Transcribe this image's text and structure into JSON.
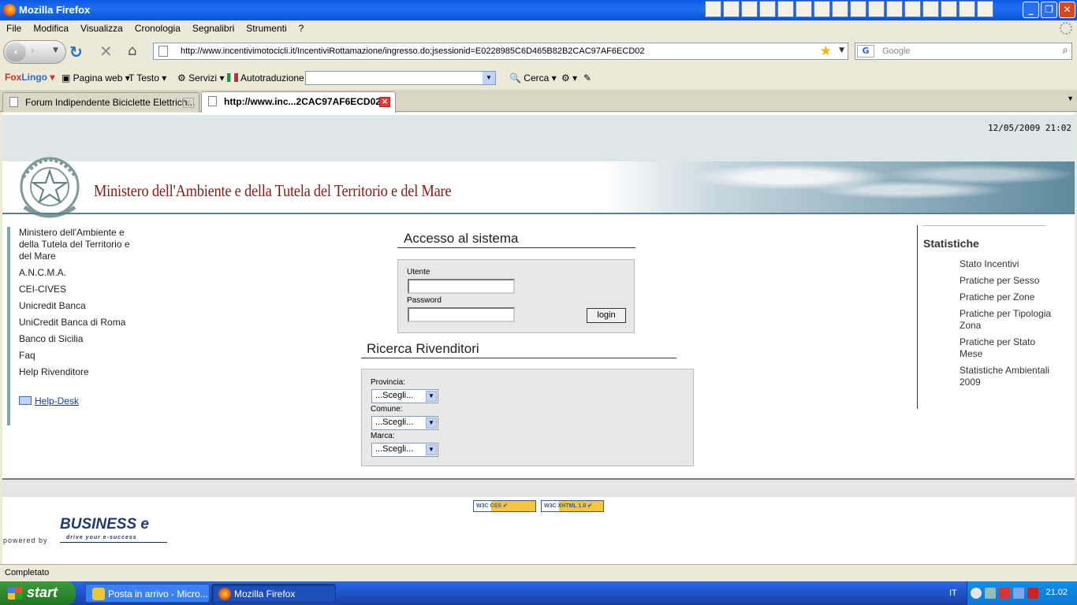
{
  "window": {
    "title": "Mozilla Firefox"
  },
  "menu": [
    "File",
    "Modifica",
    "Visualizza",
    "Cronologia",
    "Segnalibri",
    "Strumenti",
    "?"
  ],
  "nav": {
    "url": "http://www.incentivimotocicli.it/IncentiviRottamazione/ingresso.do;jsessionid=E0228985C6D465B82B2CAC97AF6ECD02",
    "search_placeholder": "Google"
  },
  "foxbar": {
    "brand_part1": "Fox",
    "brand_part2": "Lingo",
    "items": [
      "Pagina web",
      "Testo",
      "Servizi",
      "Autotraduzione",
      "Cerca"
    ]
  },
  "tabs": [
    {
      "label": "Forum Indipendente Biciclette Elettrich...",
      "active": false
    },
    {
      "label": "http://www.inc...2CAC97AF6ECD02",
      "active": true
    }
  ],
  "page": {
    "datetime": "12/05/2009 21:02",
    "ministry_title": "Ministero dell'Ambiente e della Tutela  del Territorio e del Mare",
    "left_nav": [
      "Ministero dell'Ambiente e della Tutela del Territorio e del Mare",
      "A.N.C.M.A.",
      "CEI-CIVES",
      "Unicredit Banca",
      "UniCredit Banca di Roma",
      "Banco di Sicilia",
      "Faq",
      "Help Rivenditore"
    ],
    "helpdesk": "Help-Desk",
    "login": {
      "title": "Accesso al sistema",
      "user_label": "Utente",
      "password_label": "Password",
      "button": "login"
    },
    "search": {
      "title": "Ricerca Rivenditori",
      "provincia_label": "Provincia:",
      "comune_label": "Comune:",
      "marca_label": "Marca:",
      "select_value": "...Scegli..."
    },
    "stats": {
      "heading": "Statistiche",
      "items": [
        "Stato Incentivi",
        "Pratiche per Sesso",
        "Pratiche per Zone",
        "Pratiche per Tipologia Zona",
        "Pratiche per Stato Mese",
        "Statistiche Ambientali 2009"
      ]
    },
    "badges": {
      "css": "W3C CSS ✔",
      "xhtml": "W3C XHTML 1.0 ✔"
    },
    "powered_by": "powered by",
    "business_logo": "BUSINESS e",
    "business_tagline": "drive your e-success"
  },
  "status": "Completato",
  "taskbar": {
    "start": "start",
    "tasks": [
      "Posta in arrivo - Micro...",
      "Mozilla Firefox"
    ],
    "lang": "IT",
    "clock": "21.02"
  }
}
